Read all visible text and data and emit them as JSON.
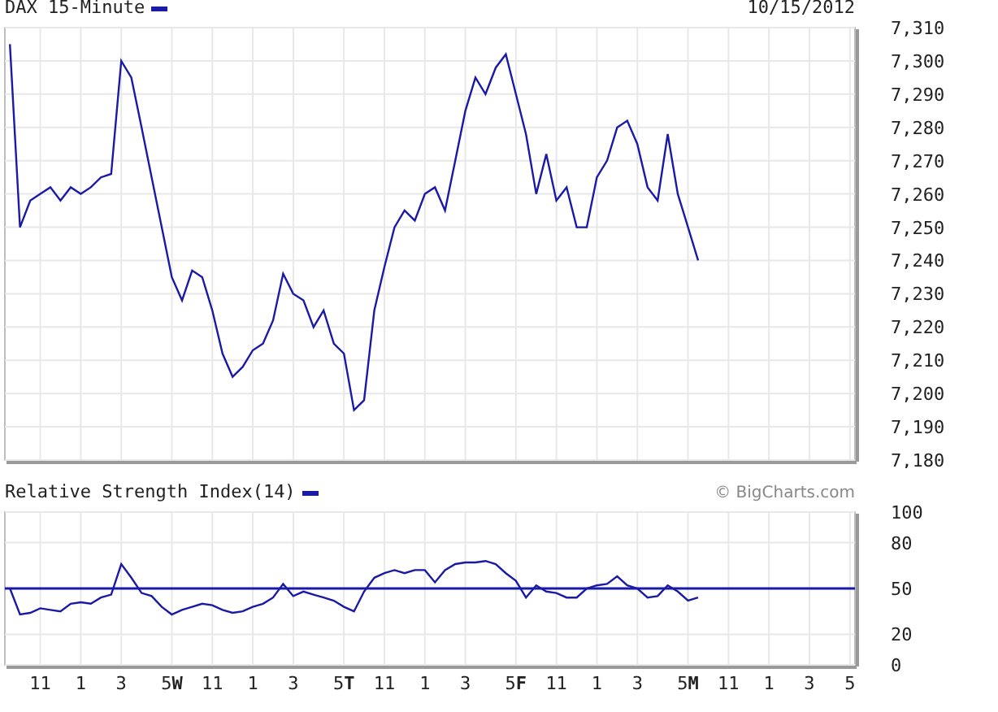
{
  "price_chart": {
    "date": "10/15/2012",
    "chart_data": {
      "type": "line",
      "grid": true,
      "ylim": [
        7180,
        7310
      ],
      "yticks": [
        {
          "value": 7310,
          "label": "7,310"
        },
        {
          "value": 7300,
          "label": "7,300"
        },
        {
          "value": 7290,
          "label": "7,290"
        },
        {
          "value": 7280,
          "label": "7,280"
        },
        {
          "value": 7270,
          "label": "7,270"
        },
        {
          "value": 7260,
          "label": "7,260"
        },
        {
          "value": 7250,
          "label": "7,250"
        },
        {
          "value": 7240,
          "label": "7,240"
        },
        {
          "value": 7230,
          "label": "7,230"
        },
        {
          "value": 7220,
          "label": "7,220"
        },
        {
          "value": 7210,
          "label": "7,210"
        },
        {
          "value": 7200,
          "label": "7,200"
        },
        {
          "value": 7190,
          "label": "7,190"
        },
        {
          "value": 7180,
          "label": "7,180"
        }
      ],
      "categories": [
        null,
        null,
        null,
        null,
        null,
        null,
        null,
        null,
        null,
        null,
        null,
        null,
        null,
        null,
        null,
        null,
        null,
        null,
        null,
        null,
        null,
        null,
        null,
        null,
        null,
        null,
        null,
        null,
        null,
        null,
        null,
        null,
        null,
        null,
        null,
        null,
        null,
        null,
        null,
        null,
        null,
        null,
        null,
        null,
        null,
        null,
        null,
        null,
        null,
        null,
        null,
        null,
        null,
        null,
        null,
        null,
        null,
        null,
        null,
        null,
        null,
        null,
        null,
        null,
        null,
        null,
        null,
        null,
        null,
        null,
        null,
        null,
        null,
        null,
        null,
        null,
        null,
        null,
        null,
        null,
        null,
        null,
        null,
        null
      ],
      "series": [
        {
          "name": "DAX 15-Minute",
          "color": "#1a1aa6",
          "values": [
            7305,
            7250,
            7258,
            7260,
            7262,
            7258,
            7262,
            7260,
            7262,
            7265,
            7266,
            7300,
            7295,
            7280,
            7265,
            7250,
            7235,
            7228,
            7237,
            7235,
            7225,
            7212,
            7205,
            7208,
            7213,
            7215,
            7222,
            7236,
            7230,
            7228,
            7220,
            7225,
            7215,
            7212,
            7195,
            7198,
            7225,
            7238,
            7250,
            7255,
            7252,
            7260,
            7262,
            7255,
            7270,
            7285,
            7295,
            7290,
            7298,
            7302,
            7290,
            7278,
            7260,
            7272,
            7258,
            7262,
            7250,
            7250,
            7265,
            7270,
            7280,
            7282,
            7275,
            7262,
            7258,
            7278,
            7260,
            7250,
            7240,
            null,
            null,
            null,
            null,
            null,
            null,
            null,
            null,
            null,
            null,
            null,
            null,
            null,
            null,
            null
          ]
        }
      ]
    }
  },
  "rsi_chart": {
    "credit": "© BigCharts.com",
    "chart_data": {
      "type": "line",
      "grid": true,
      "ylim": [
        0,
        100
      ],
      "yticks": [
        100,
        80,
        50,
        20,
        0
      ],
      "categories": [
        null,
        null,
        null,
        "11",
        null,
        null,
        null,
        "1",
        null,
        null,
        null,
        "3",
        null,
        null,
        null,
        null,
        "5**W**",
        null,
        null,
        null,
        "11",
        null,
        null,
        null,
        "1",
        null,
        null,
        null,
        "3",
        null,
        null,
        null,
        null,
        "5**T**",
        null,
        null,
        null,
        "11",
        null,
        null,
        null,
        "1",
        null,
        null,
        null,
        "3",
        null,
        null,
        null,
        null,
        "5**F**",
        null,
        null,
        null,
        "11",
        null,
        null,
        null,
        "1",
        null,
        null,
        null,
        "3",
        null,
        null,
        null,
        null,
        "5**M**",
        null,
        null,
        null,
        "11",
        null,
        null,
        null,
        "1",
        null,
        null,
        null,
        "3",
        null,
        null,
        null,
        "5"
      ],
      "series": [
        {
          "name": "Relative Strength Index(14)",
          "color": "#1a1aa6",
          "values": [
            50,
            33,
            34,
            37,
            36,
            35,
            40,
            41,
            40,
            44,
            46,
            66,
            57,
            47,
            45,
            38,
            33,
            36,
            38,
            40,
            39,
            36,
            34,
            35,
            38,
            40,
            44,
            53,
            45,
            48,
            46,
            44,
            42,
            38,
            35,
            48,
            57,
            60,
            62,
            60,
            62,
            62,
            54,
            62,
            66,
            67,
            67,
            68,
            66,
            60,
            55,
            44,
            52,
            48,
            47,
            44,
            44,
            50,
            52,
            53,
            58,
            52,
            50,
            44,
            45,
            52,
            48,
            42,
            44,
            null,
            null,
            null,
            null,
            null,
            null,
            null,
            null,
            null,
            null,
            null,
            null,
            null,
            null,
            null
          ]
        }
      ],
      "ref_lines": [
        {
          "axis": "y",
          "value": 50
        }
      ]
    }
  }
}
